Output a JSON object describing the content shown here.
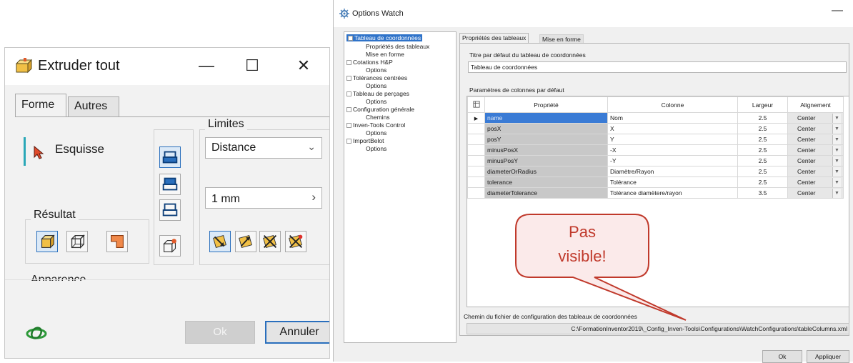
{
  "extruder": {
    "title": "Extruder tout",
    "tabs": [
      "Forme",
      "Autres"
    ],
    "selection_label": "Esquisse",
    "result_label": "Résultat",
    "limits_label": "Limites",
    "distance_select": "Distance",
    "distance_value": "1 mm",
    "appearance_label": "Apparence",
    "ok_label": "Ok",
    "cancel_label": "Annuler",
    "accent_color": "#2aa8b8"
  },
  "options": {
    "title": "Options Watch",
    "tree": [
      {
        "label": "Tableau de coordonnées",
        "selected": true
      },
      {
        "label": "Propriétés des tableaux"
      },
      {
        "label": "Mise en forme"
      },
      {
        "label": "Cotations H&P"
      },
      {
        "label": "Options"
      },
      {
        "label": "Tolérances centrées"
      },
      {
        "label": "Options"
      },
      {
        "label": "Tableau de perçages"
      },
      {
        "label": "Options"
      },
      {
        "label": "Configuration générale"
      },
      {
        "label": "Chemins"
      },
      {
        "label": "Inven-Tools Control"
      },
      {
        "label": "Options"
      },
      {
        "label": "ImportBelot"
      },
      {
        "label": "Options"
      }
    ],
    "tabs": [
      "Propriétés des tableaux",
      "Mise en forme"
    ],
    "default_title_label": "Titre par défaut du tableau de coordonnées",
    "default_title_value": "Tableau de coordonnées",
    "columns_label": "Paramètres de colonnes par défaut",
    "grid": {
      "headers": [
        "Propriété",
        "Colonne",
        "Largeur",
        "Alignement"
      ],
      "rows": [
        {
          "prop": "name",
          "col": "Nom",
          "width": "2.5",
          "align": "Center"
        },
        {
          "prop": "posX",
          "col": "X",
          "width": "2.5",
          "align": "Center"
        },
        {
          "prop": "posY",
          "col": "Y",
          "width": "2.5",
          "align": "Center"
        },
        {
          "prop": "minusPosX",
          "col": "-X",
          "width": "2.5",
          "align": "Center"
        },
        {
          "prop": "minusPosY",
          "col": "-Y",
          "width": "2.5",
          "align": "Center"
        },
        {
          "prop": "diameterOrRadius",
          "col": "Diamètre/Rayon",
          "width": "2.5",
          "align": "Center"
        },
        {
          "prop": "tolerance",
          "col": "Tolérance",
          "width": "2.5",
          "align": "Center"
        },
        {
          "prop": "diameterTolerance",
          "col": "Tolérance diamètere/rayon",
          "width": "3.5",
          "align": "Center"
        }
      ]
    },
    "path_label": "Chemin du fichier de configuration des tableaux de coordonnées",
    "path_value": "C:\\FormationInventor2019\\_Config_Inven-Tools\\Configurations\\WatchConfigurations\\tableColumns.xml",
    "buttons": [
      "Ok",
      "Appliquer"
    ]
  },
  "callout": {
    "line1": "Pas",
    "line2": "visible!",
    "color": "#c0392b"
  }
}
